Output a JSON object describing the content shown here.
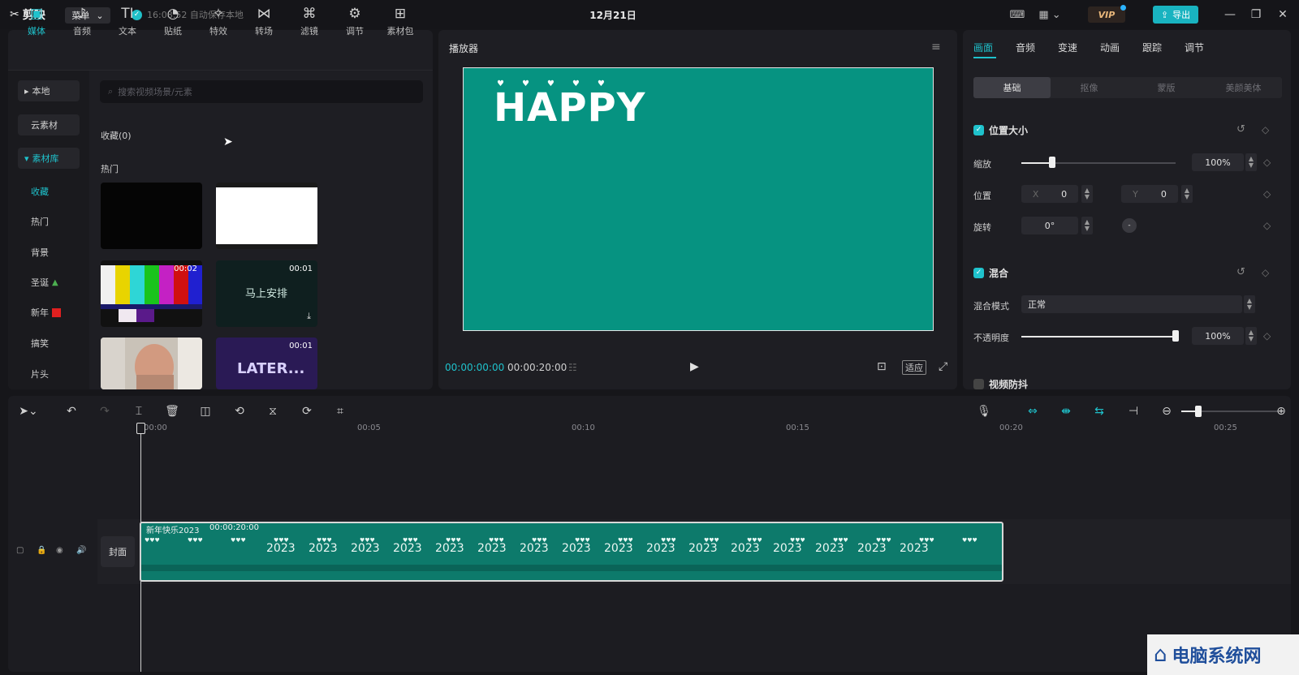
{
  "app": {
    "name": "剪映",
    "menu_label": "菜单",
    "autosave": "16:08:52 自动保存本地",
    "project_title": "12月21日",
    "vip_label": "VIP",
    "export_label": "导出"
  },
  "toolbar": {
    "items": [
      {
        "label": "媒体",
        "icon": "media-icon"
      },
      {
        "label": "音频",
        "icon": "audio-icon"
      },
      {
        "label": "文本",
        "icon": "text-icon"
      },
      {
        "label": "贴纸",
        "icon": "sticker-icon"
      },
      {
        "label": "特效",
        "icon": "effects-icon"
      },
      {
        "label": "转场",
        "icon": "transition-icon"
      },
      {
        "label": "滤镜",
        "icon": "filter-icon"
      },
      {
        "label": "调节",
        "icon": "adjust-icon"
      },
      {
        "label": "素材包",
        "icon": "material-pack-icon"
      }
    ]
  },
  "sidebar": {
    "local": "本地",
    "cloud": "云素材",
    "library": "素材库",
    "items": [
      "收藏",
      "热门",
      "背景",
      "圣诞",
      "新年",
      "搞笑",
      "片头"
    ]
  },
  "library": {
    "search_placeholder": "搜索视频场景/元素",
    "favorites": "收藏(0)",
    "hot": "热门",
    "thumbs": [
      {
        "duration": ""
      },
      {
        "duration": ""
      },
      {
        "duration": "00:02"
      },
      {
        "duration": "00:01",
        "text": "马上安排"
      },
      {
        "duration": ""
      },
      {
        "duration": "00:01",
        "text": "LATER..."
      }
    ]
  },
  "player": {
    "title": "播放器",
    "canvas_text": "HAPPY",
    "current_time": "00:00:00:00",
    "total_time": "00:00:20:00",
    "fit_label": "适应",
    "canvas_color": "#069381"
  },
  "props": {
    "tabs": [
      "画面",
      "音频",
      "变速",
      "动画",
      "跟踪",
      "调节"
    ],
    "subtabs": [
      "基础",
      "抠像",
      "蒙版",
      "美颜美体"
    ],
    "position_size": "位置大小",
    "scale_label": "缩放",
    "scale_value": "100%",
    "scale_level": 0.2,
    "position_label": "位置",
    "x_label": "X",
    "x_value": "0",
    "y_label": "Y",
    "y_value": "0",
    "rotate_label": "旋转",
    "rotate_value": "0°",
    "blend": "混合",
    "blend_mode_label": "混合模式",
    "blend_mode_value": "正常",
    "opacity_label": "不透明度",
    "opacity_value": "100%",
    "opacity_level": 1.0,
    "stabilize": "视频防抖"
  },
  "timeline": {
    "ticks": [
      "00:00",
      "00:05",
      "00:10",
      "00:15",
      "00:20",
      "00:25"
    ],
    "clip_name": "新年快乐2023",
    "clip_duration": "00:00:20:00",
    "cover_label": "封面",
    "clip_pattern_text": "2023"
  },
  "watermark": {
    "text": "电脑系统网"
  },
  "colors": {
    "accent": "#1fc2cc",
    "clip": "#0d7a6b",
    "bg": "#16161a"
  }
}
